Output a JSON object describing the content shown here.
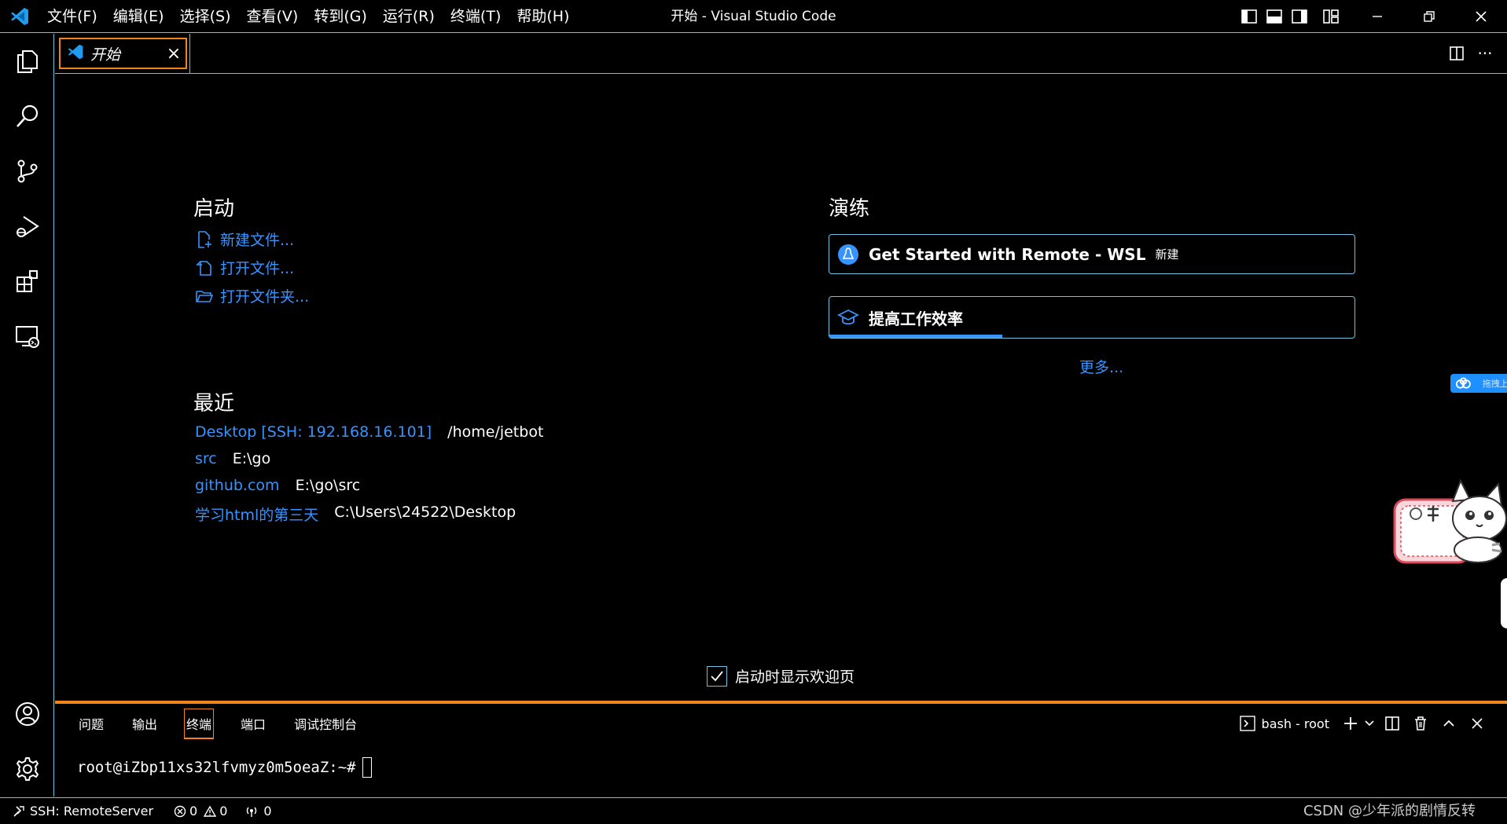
{
  "titlebar": {
    "window_title": "开始 - Visual Studio Code",
    "menu": [
      "文件(F)",
      "编辑(E)",
      "选择(S)",
      "查看(V)",
      "转到(G)",
      "运行(R)",
      "终端(T)",
      "帮助(H)"
    ]
  },
  "tab": {
    "label": "开始",
    "close": "×"
  },
  "editor_actions": {
    "more": "···"
  },
  "welcome": {
    "start_title": "启动",
    "start_links": [
      "新建文件...",
      "打开文件...",
      "打开文件夹..."
    ],
    "recent_title": "最近",
    "recent": [
      {
        "name": "Desktop [SSH: 192.168.16.101]",
        "path": "/home/jetbot"
      },
      {
        "name": "src",
        "path": "E:\\go"
      },
      {
        "name": "github.com",
        "path": "E:\\go\\src"
      },
      {
        "name": "学习html的第三天",
        "path": "C:\\Users\\24522\\Desktop"
      }
    ],
    "walkthroughs_title": "演练",
    "walkthroughs": [
      {
        "label": "Get Started with Remote - WSL",
        "badge": "新建"
      },
      {
        "label": "提高工作效率",
        "progress": 0.33
      }
    ],
    "more": "更多...",
    "show_on_startup": "启动时显示欢迎页"
  },
  "panel": {
    "tabs": [
      "问题",
      "输出",
      "终端",
      "端口",
      "调试控制台"
    ],
    "active_tab": "终端",
    "terminal_name": "bash - root",
    "prompt": "root@iZbp11xs32lfvmyz0m5oeaZ:~#"
  },
  "statusbar": {
    "remote": "SSH: RemoteServer",
    "errors": "0",
    "warnings": "0",
    "ports": "0"
  },
  "watermark": "CSDN @少年派的剧情反转",
  "float_widget": {
    "label": "拖拽上"
  },
  "colors": {
    "background": "#000000",
    "border": "#6fc3df",
    "focus": "#f38518",
    "link": "#3794ff"
  }
}
